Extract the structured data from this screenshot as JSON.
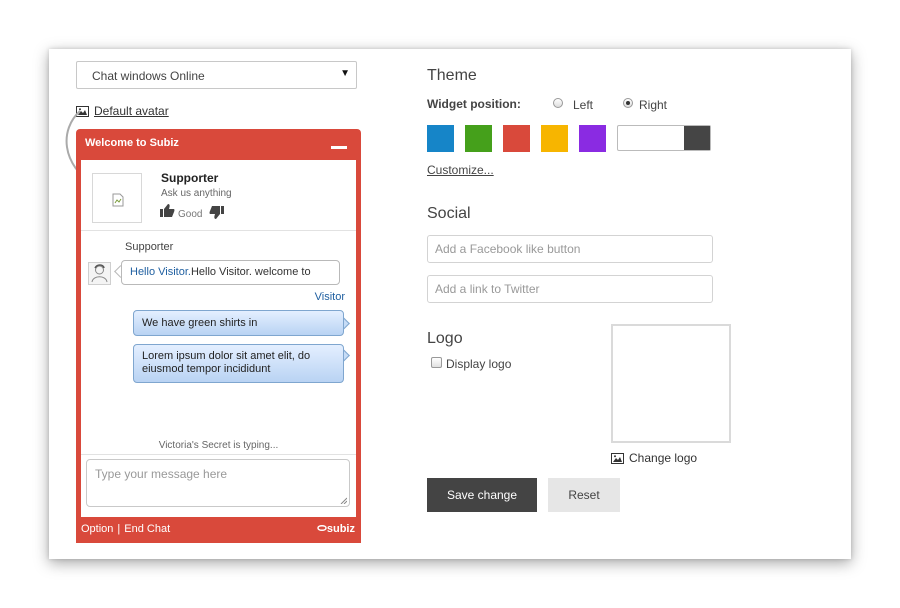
{
  "left": {
    "dropdown_value": "Chat windows Online",
    "default_avatar_label": "Default avatar"
  },
  "widget": {
    "title": "Welcome to Subiz",
    "supporter_name": "Supporter",
    "supporter_tagline": "Ask us anything",
    "rating_label": "Good",
    "messages": [
      {
        "sender": "Supporter",
        "text_highlight": "Hello Visitor.",
        "text": "Hello Visitor. welcome to"
      },
      {
        "sender": "Visitor",
        "text": "We have green shirts in"
      },
      {
        "sender": "Visitor",
        "text": "Lorem ipsum dolor sit amet elit, do eiusmod tempor incididunt"
      }
    ],
    "typing_status": "Victoria's Secret is typing...",
    "input_placeholder": "Type your message here",
    "footer_option": "Option",
    "footer_separator": "|",
    "footer_end_chat": "End Chat",
    "brand": "subiz"
  },
  "theme": {
    "heading": "Theme",
    "widget_position_label": "Widget position:",
    "position_options": [
      "Left",
      "Right"
    ],
    "selected_position": "Right",
    "colors": [
      "#1685c8",
      "#45a01b",
      "#d9493b",
      "#f7b500",
      "#8a2be2"
    ],
    "dark_toggle_color": "#454545",
    "customize_label": "Customize..."
  },
  "social": {
    "heading": "Social",
    "facebook_placeholder": "Add a Facebook like button",
    "twitter_placeholder": "Add a link to Twitter"
  },
  "logo": {
    "heading": "Logo",
    "display_logo_label": "Display logo",
    "display_logo_checked": false,
    "change_logo_label": "Change logo"
  },
  "actions": {
    "save_label": "Save change",
    "reset_label": "Reset"
  }
}
